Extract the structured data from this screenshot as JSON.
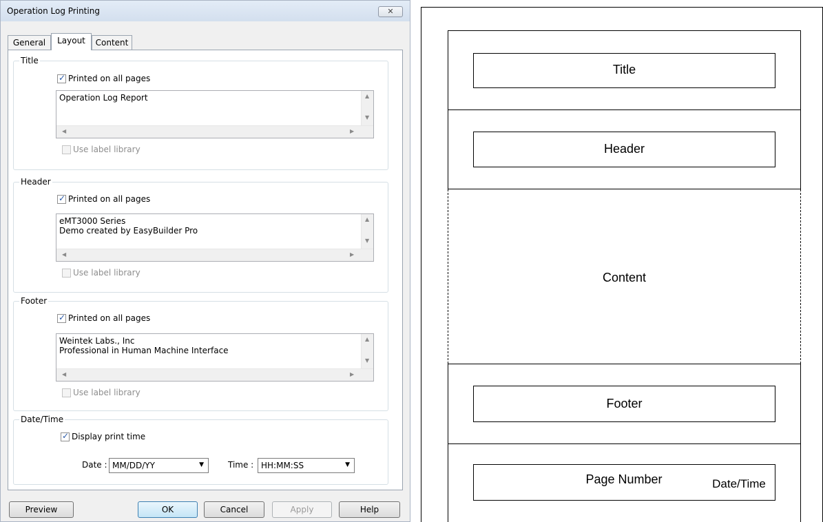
{
  "dialog": {
    "title": "Operation Log Printing",
    "close_icon": "close-icon",
    "tabs": [
      {
        "label": "General",
        "active": false
      },
      {
        "label": "Layout",
        "active": true
      },
      {
        "label": "Content",
        "active": false
      }
    ],
    "title_group": {
      "legend": "Title",
      "printed_on_all_pages": {
        "label": "Printed on all pages",
        "checked": true
      },
      "text": "Operation Log Report",
      "use_label_library": {
        "label": "Use label library",
        "checked": false,
        "enabled": false
      }
    },
    "header_group": {
      "legend": "Header",
      "printed_on_all_pages": {
        "label": "Printed on all pages",
        "checked": true
      },
      "text": "eMT3000 Series\nDemo created by EasyBuilder Pro",
      "use_label_library": {
        "label": "Use label library",
        "checked": false,
        "enabled": false
      }
    },
    "footer_group": {
      "legend": "Footer",
      "printed_on_all_pages": {
        "label": "Printed on all pages",
        "checked": true
      },
      "text": "Weintek Labs., Inc\nProfessional in Human Machine Interface",
      "use_label_library": {
        "label": "Use label library",
        "checked": false,
        "enabled": false
      }
    },
    "datetime_group": {
      "legend": "Date/Time",
      "display_print_time": {
        "label": "Display print time",
        "checked": true
      },
      "date_label": "Date :",
      "date_value": "MM/DD/YY",
      "time_label": "Time :",
      "time_value": "HH:MM:SS"
    },
    "buttons": {
      "preview": "Preview",
      "ok": "OK",
      "cancel": "Cancel",
      "apply": "Apply",
      "help": "Help"
    }
  },
  "layout_preview": {
    "title": "Title",
    "header": "Header",
    "content": "Content",
    "footer": "Footer",
    "page_number": "Page Number",
    "date_time": "Date/Time"
  }
}
